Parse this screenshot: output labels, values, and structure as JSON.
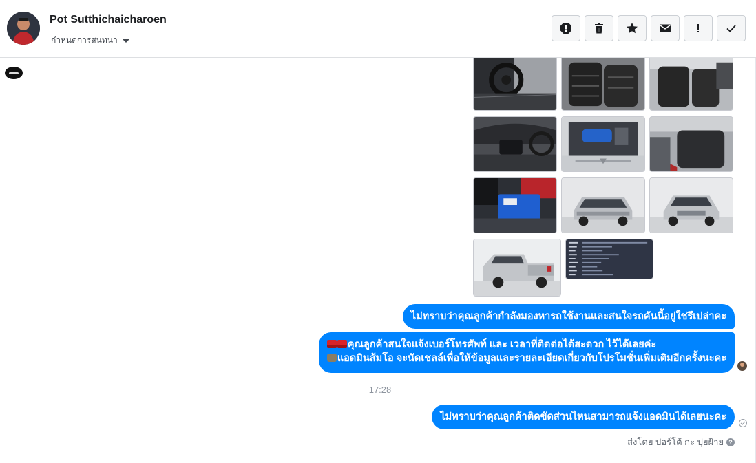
{
  "conversation": {
    "contact_name": "Pot Sutthichaicharoen",
    "status_label": "กำหนดการสนทนา"
  },
  "header_actions": [
    {
      "name": "report-icon"
    },
    {
      "name": "delete-icon"
    },
    {
      "name": "star-icon"
    },
    {
      "name": "mail-icon"
    },
    {
      "name": "important-icon"
    },
    {
      "name": "check-icon"
    }
  ],
  "photos": [
    {
      "name": "photo-interior-steering"
    },
    {
      "name": "photo-interior-seats-1"
    },
    {
      "name": "photo-interior-seats-2"
    },
    {
      "name": "photo-dashboard"
    },
    {
      "name": "photo-engine"
    },
    {
      "name": "photo-rear-seats"
    },
    {
      "name": "photo-engine-battery"
    },
    {
      "name": "photo-front-view-1"
    },
    {
      "name": "photo-front-view-2"
    },
    {
      "name": "photo-rear-view"
    },
    {
      "name": "photo-info-card"
    }
  ],
  "messages": {
    "m1": "ไม่ทราบว่าคุณลูกค้ากำลังมองหารถใช้งานและสนใจรถคันนี้อยู่ใช่รึเปล่าคะ",
    "m2_line1": "คุณลูกค้าสนใจแจ้งเบอร์โทรศัพท์ และ เวลาที่ติดต่อได้สะดวก ไว้ได้เลยค่ะ",
    "m2_line2": "แอดมินส้มโอ จะนัดเชลล์เพื่อให้ข้อมูลและรายละเอียดเกี่ยวกับโปรโมชั่นเพิ่มเติมอีกครั้งนะคะ",
    "timestamp": "17:28",
    "m3": "ไม่ทราบว่าคุณลูกค้าติดขัดส่วนไหนสามารถแจ้งแอดมินได้เลยนะคะ",
    "sent_by": "ส่งโดย ปอร์โต้ กะ ปุยฝ้าย"
  },
  "colors": {
    "bubble": "#0084ff",
    "action_bg": "#f5f6f7",
    "border": "#dddfe2"
  }
}
